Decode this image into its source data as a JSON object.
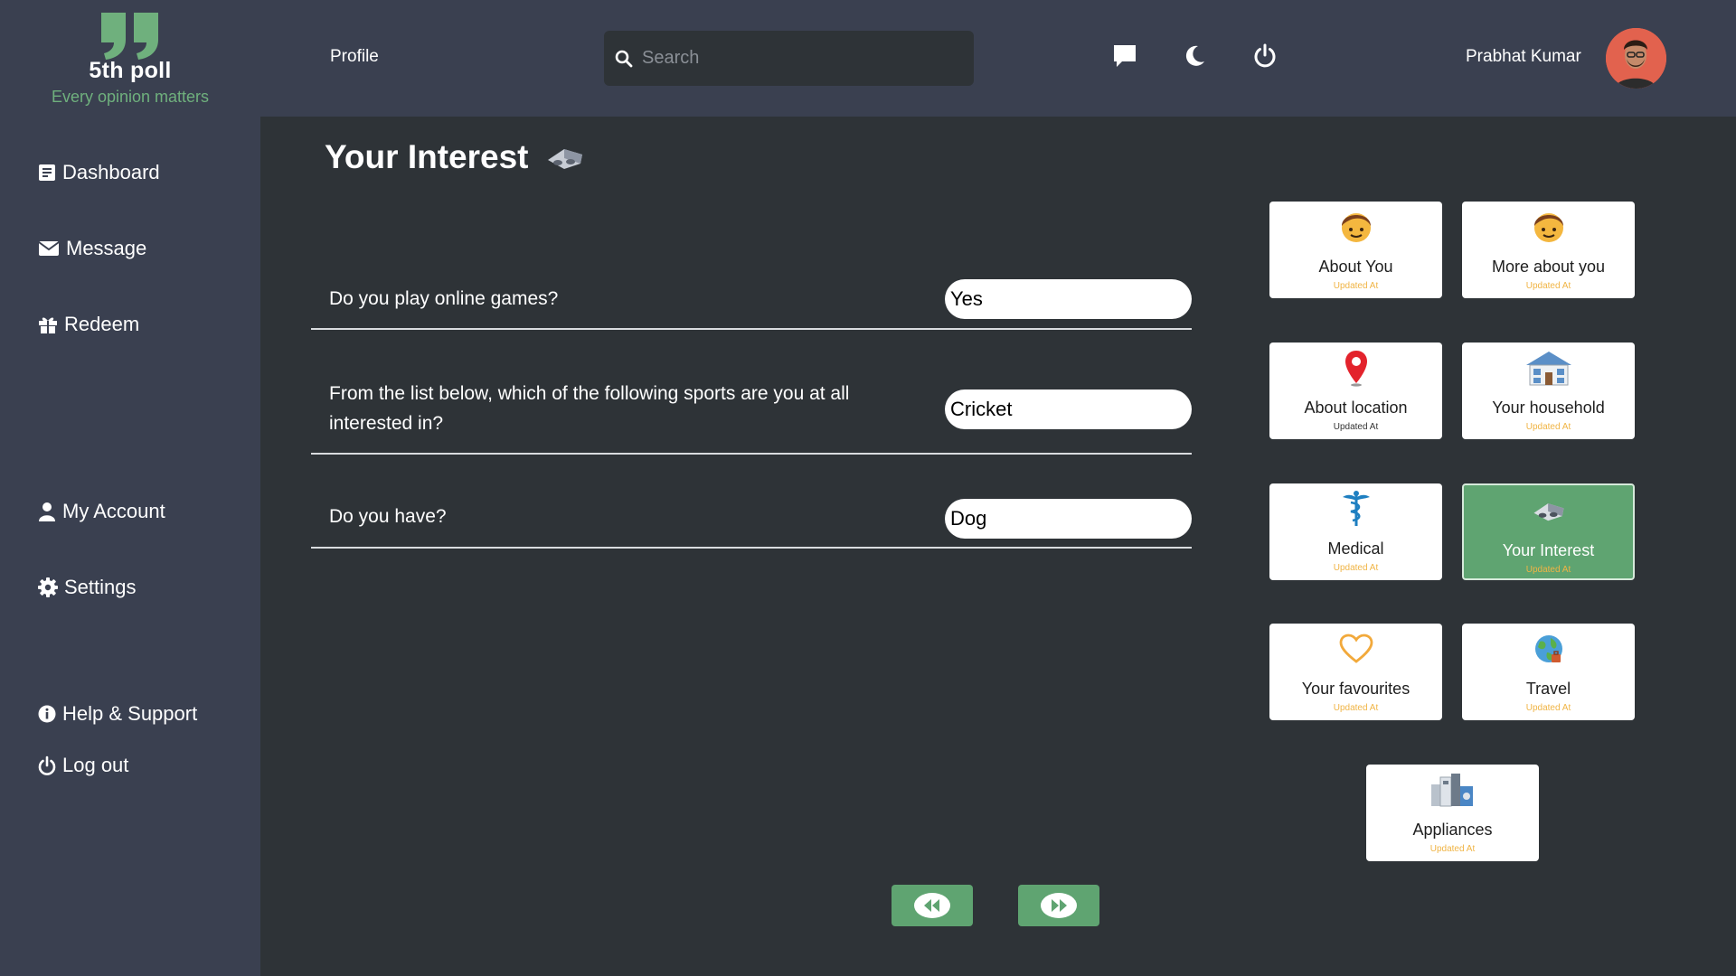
{
  "brand": {
    "name": "5th poll",
    "tagline": "Every opinion matters",
    "accent": "#6fb07d"
  },
  "header": {
    "profile_label": "Profile",
    "search": {
      "placeholder": "Search",
      "value": ""
    },
    "icons": [
      "chat-icon",
      "moon-icon",
      "power-icon"
    ],
    "user_name": "Prabhat Kumar"
  },
  "sidebar": {
    "items": [
      {
        "label": "Dashboard",
        "icon": "clipboard-icon"
      },
      {
        "label": "Message",
        "icon": "envelope-icon"
      },
      {
        "label": "Redeem",
        "icon": "gift-icon"
      },
      {
        "label": "My Account",
        "icon": "user-icon"
      },
      {
        "label": "Settings",
        "icon": "gear-icon"
      },
      {
        "label": "Help & Support",
        "icon": "info-icon"
      },
      {
        "label": "Log out",
        "icon": "power-icon"
      }
    ]
  },
  "main": {
    "title": "Your Interest",
    "questions": [
      {
        "text": "Do you play online games?",
        "answer": "Yes"
      },
      {
        "text": "From the list below, which of the following sports are you at all interested in?",
        "answer": "Cricket"
      },
      {
        "text": "Do you have?",
        "answer": "Dog"
      }
    ]
  },
  "cards": [
    {
      "title": "About You",
      "subtitle": "Updated At",
      "icon": "boy-icon",
      "active": false
    },
    {
      "title": "More about you",
      "subtitle": "Updated At",
      "icon": "boy-icon",
      "active": false
    },
    {
      "title": "About location",
      "subtitle": "Updated At",
      "icon": "location-pin-icon",
      "active": false
    },
    {
      "title": "Your household",
      "subtitle": "Updated At",
      "icon": "house-icon",
      "active": false
    },
    {
      "title": "Medical",
      "subtitle": "Updated At",
      "icon": "caduceus-icon",
      "active": false
    },
    {
      "title": "Your Interest",
      "subtitle": "Updated At",
      "icon": "vr-headset-icon",
      "active": true
    },
    {
      "title": "Your favourites",
      "subtitle": "Updated At",
      "icon": "heart-icon",
      "active": false
    },
    {
      "title": "Travel",
      "subtitle": "Updated At",
      "icon": "globe-travel-icon",
      "active": false
    },
    {
      "title": "Appliances",
      "subtitle": "Updated At",
      "icon": "appliances-icon",
      "active": false
    }
  ],
  "pager": {
    "prev_icon": "rewind-icon",
    "next_icon": "fast-forward-icon"
  },
  "colors": {
    "header_bg": "#3a4050",
    "main_bg": "#2e3337",
    "active_card": "#5fa471",
    "subtitle": "#f0b444"
  }
}
